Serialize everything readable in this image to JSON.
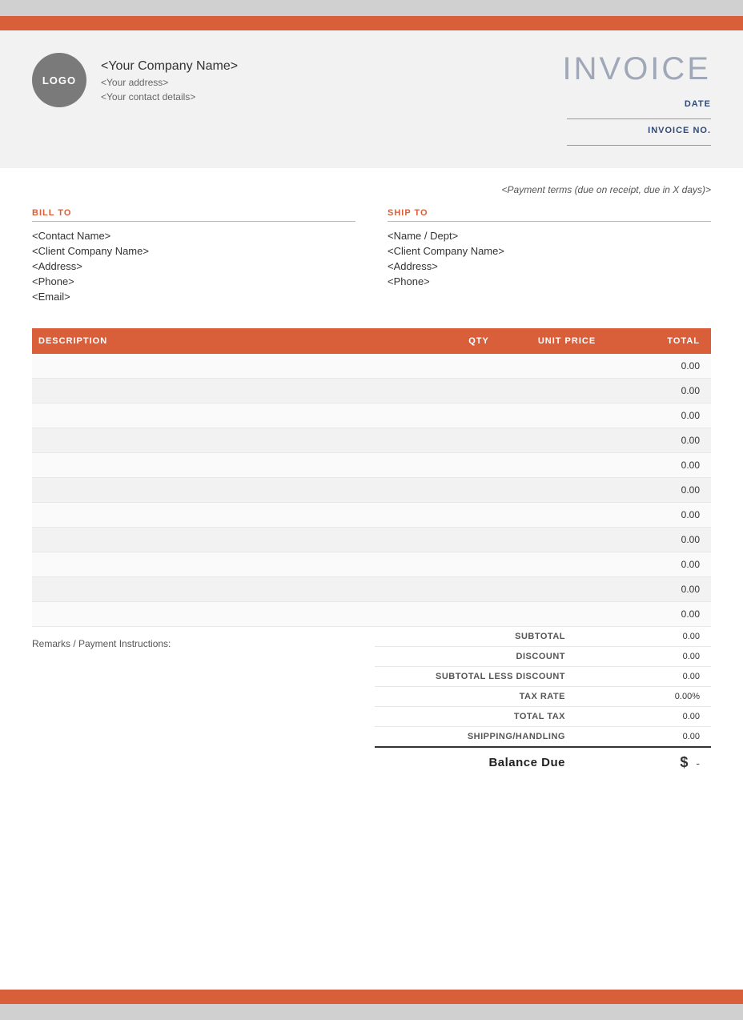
{
  "topBar": {},
  "header": {
    "logo_text": "LOGO",
    "company_name": "<Your Company Name>",
    "company_address": "<Your address>",
    "company_contact": "<Your contact details>",
    "invoice_title": "INVOICE",
    "date_label": "DATE",
    "invoice_no_label": "INVOICE NO."
  },
  "body": {
    "payment_terms": "<Payment terms (due on receipt, due in X days)>",
    "bill_to": {
      "label": "BILL TO",
      "contact_name": "<Contact Name>",
      "company_name": "<Client Company Name>",
      "address": "<Address>",
      "phone": "<Phone>",
      "email": "<Email>"
    },
    "ship_to": {
      "label": "SHIP TO",
      "name_dept": "<Name / Dept>",
      "company_name": "<Client Company Name>",
      "address": "<Address>",
      "phone": "<Phone>"
    },
    "table": {
      "col_description": "DESCRIPTION",
      "col_qty": "QTY",
      "col_unit_price": "UNIT PRICE",
      "col_total": "TOTAL",
      "rows": [
        {
          "description": "",
          "qty": "",
          "unit_price": "",
          "total": "0.00"
        },
        {
          "description": "",
          "qty": "",
          "unit_price": "",
          "total": "0.00"
        },
        {
          "description": "",
          "qty": "",
          "unit_price": "",
          "total": "0.00"
        },
        {
          "description": "",
          "qty": "",
          "unit_price": "",
          "total": "0.00"
        },
        {
          "description": "",
          "qty": "",
          "unit_price": "",
          "total": "0.00"
        },
        {
          "description": "",
          "qty": "",
          "unit_price": "",
          "total": "0.00"
        },
        {
          "description": "",
          "qty": "",
          "unit_price": "",
          "total": "0.00"
        },
        {
          "description": "",
          "qty": "",
          "unit_price": "",
          "total": "0.00"
        },
        {
          "description": "",
          "qty": "",
          "unit_price": "",
          "total": "0.00"
        },
        {
          "description": "",
          "qty": "",
          "unit_price": "",
          "total": "0.00"
        },
        {
          "description": "",
          "qty": "",
          "unit_price": "",
          "total": "0.00"
        }
      ]
    },
    "remarks_label": "Remarks / Payment Instructions:",
    "totals": {
      "subtotal_label": "SUBTOTAL",
      "subtotal_value": "0.00",
      "discount_label": "DISCOUNT",
      "discount_value": "0.00",
      "subtotal_less_label": "SUBTOTAL LESS DISCOUNT",
      "subtotal_less_value": "0.00",
      "tax_rate_label": "TAX RATE",
      "tax_rate_value": "0.00%",
      "total_tax_label": "TOTAL TAX",
      "total_tax_value": "0.00",
      "shipping_label": "SHIPPING/HANDLING",
      "shipping_value": "0.00",
      "balance_due_label": "Balance Due",
      "balance_currency": "$",
      "balance_value": "-"
    }
  }
}
